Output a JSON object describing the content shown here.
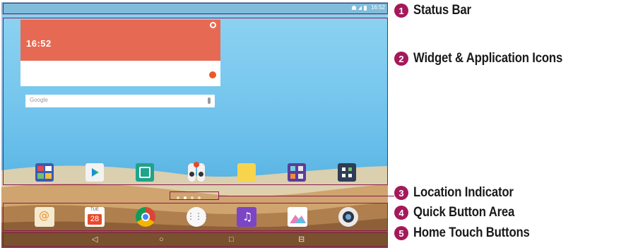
{
  "screen": {
    "status_time": "16:52",
    "clock_time": "16:52",
    "search_placeholder": "Google",
    "calendar_day": "TUE",
    "calendar_date": "28",
    "home_apps": [
      "email-icon",
      "play-store-icon",
      "smart-switch-icon",
      "qslide-icon",
      "memo-icon",
      "tools-folder-icon",
      "settings-icon"
    ],
    "dock_apps": [
      "contacts-icon",
      "calendar-icon",
      "chrome-icon",
      "apps-drawer-icon",
      "music-icon",
      "gallery-icon",
      "camera-icon"
    ],
    "nav_buttons": [
      "back-icon",
      "home-icon",
      "recent-apps-icon",
      "dual-window-icon"
    ]
  },
  "callouts": [
    {
      "number": "1",
      "label": "Status Bar"
    },
    {
      "number": "2",
      "label": "Widget & Application Icons"
    },
    {
      "number": "3",
      "label": "Location Indicator"
    },
    {
      "number": "4",
      "label": "Quick Button Area"
    },
    {
      "number": "5",
      "label": "Home Touch Buttons"
    }
  ],
  "colors": {
    "callout": "#a4195a",
    "frame": "#8a1c4c",
    "clock_widget": "#e66a53"
  }
}
